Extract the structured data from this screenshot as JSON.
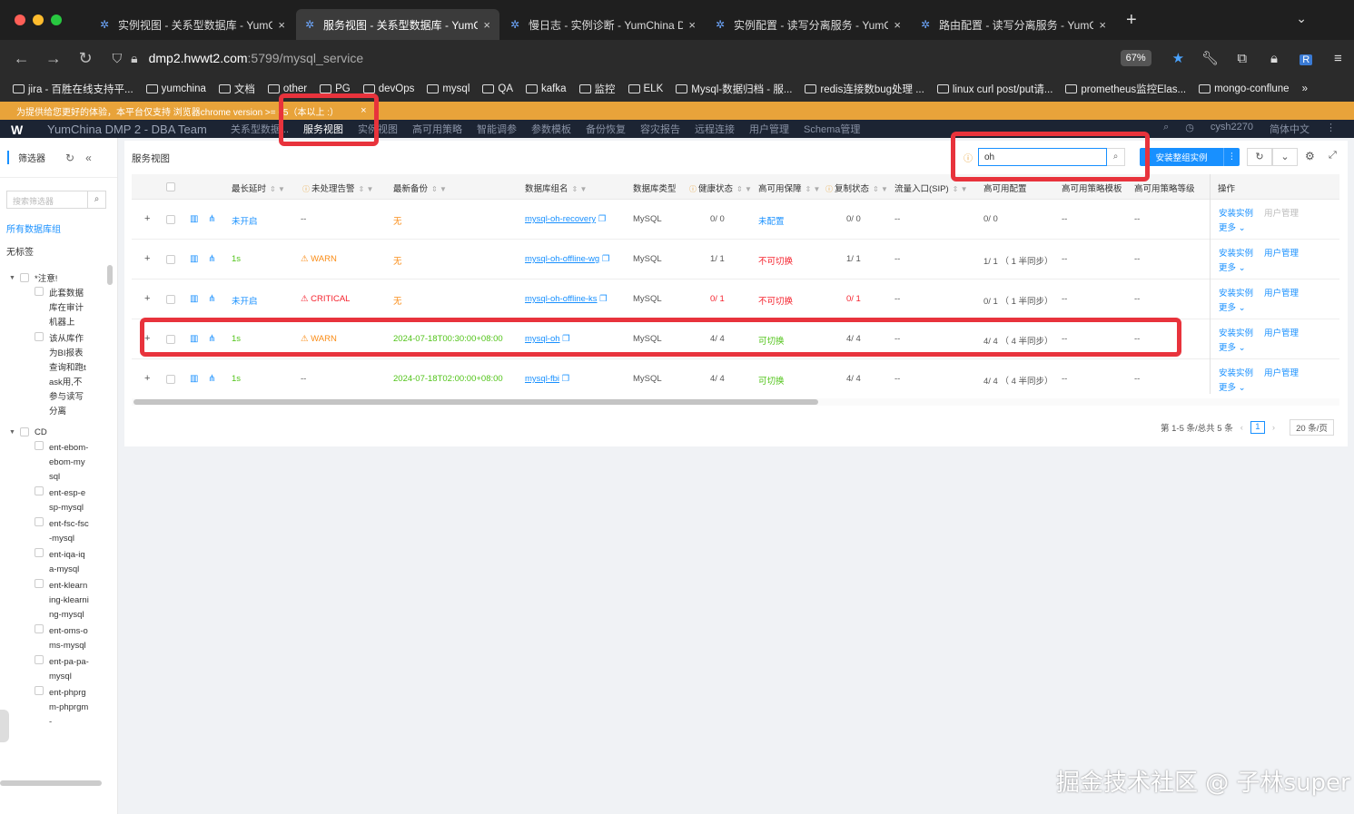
{
  "browser": {
    "tabs": [
      {
        "title": "实例视图 - 关系型数据库 - YumC",
        "active": false
      },
      {
        "title": "服务视图 - 关系型数据库 - YumC",
        "active": true
      },
      {
        "title": "慢日志 - 实例诊断 - YumChina D",
        "active": false
      },
      {
        "title": "实例配置 - 读写分离服务 - YumC",
        "active": false
      },
      {
        "title": "路由配置 - 读写分离服务 - YumC",
        "active": false
      }
    ],
    "url_host": "dmp2.hwwt2.com",
    "url_rest": ":5799/mysql_service",
    "url_prefix": "",
    "zoom": "67%",
    "bookmarks": [
      "jira - 百胜在线支持平...",
      "yumchina",
      "文档",
      "other",
      "PG",
      "devOps",
      "mysql",
      "QA",
      "kafka",
      "监控",
      "ELK",
      "Mysql-数据归档 - 服...",
      "redis连接数bug处理 ...",
      "linux curl post/put请...",
      "prometheus监控Elas...",
      "mongo-conflune"
    ]
  },
  "app": {
    "warning": "为提供给您更好的体验，本平台仅支持 浏览器chrome version >= 65（本以上 :）",
    "title": "YumChina DMP 2 - DBA Team",
    "nav": [
      "关系型数据...",
      "服务视图",
      "实例视图",
      "高可用策略",
      "智能调参",
      "参数模板",
      "备份恢复",
      "容灾报告",
      "远程连接",
      "用户管理",
      "Schema管理"
    ],
    "user": "cysh2270",
    "lang": "简体中文"
  },
  "sidebar": {
    "filter_label": "筛选器",
    "search_placeholder": "搜索筛选器",
    "all_groups": "所有数据库组",
    "untagged": "无标签",
    "tree": [
      {
        "group": "*注意!",
        "items": [
          "此套数据库在审计机器上",
          "该从库作为BI报表查询和跑task用,不参与读写分离"
        ]
      },
      {
        "group": "CD",
        "items": [
          "ent-ebom-ebom-mysql",
          "ent-esp-esp-mysql",
          "ent-fsc-fsc-mysql",
          "ent-iqa-iqa-mysql",
          "ent-klearning-klearning-mysql",
          "ent-oms-oms-mysql",
          "ent-pa-pa-mysql",
          "ent-phprgm-phprgm-"
        ]
      }
    ]
  },
  "panel": {
    "title": "服务视图",
    "search_value": "oh",
    "install_button": "安装整组实例",
    "columns": [
      "最长延时",
      "未处理告警",
      "最新备份",
      "数据库组名",
      "数据库类型",
      "健康状态",
      "高可用保障",
      "复制状态",
      "流量入口(SIP)",
      "高可用配置",
      "高可用策略模板",
      "高可用策略等级",
      "操作"
    ],
    "rows": [
      {
        "delay": "未开启",
        "delay_color": "#1890ff",
        "alert": "--",
        "alert_type": "none",
        "backup": "无",
        "backup_color": "#fa8c16",
        "group": "mysql-oh-recovery",
        "dbtype": "MySQL",
        "health": "0/ 0",
        "health_color": "#555",
        "ha": "未配置",
        "ha_color": "#1890ff",
        "repl": "0/ 0",
        "repl_color": "#555",
        "sip": "--",
        "haconf": "0/ 0",
        "tpl": "--",
        "level": "--",
        "op1": "安装实例",
        "op2": "用户管理",
        "op2_disabled": true,
        "op3": "更多"
      },
      {
        "delay": "1s",
        "delay_color": "#52c41a",
        "alert": "WARN",
        "alert_type": "warn",
        "backup": "无",
        "backup_color": "#fa8c16",
        "group": "mysql-oh-offline-wg",
        "dbtype": "MySQL",
        "health": "1/ 1",
        "health_color": "#555",
        "ha": "不可切换",
        "ha_color": "#f5222d",
        "repl": "1/ 1",
        "repl_color": "#555",
        "sip": "--",
        "haconf": "1/ 1 （ 1 半同步）",
        "tpl": "--",
        "level": "--",
        "op1": "安装实例",
        "op2": "用户管理",
        "op2_disabled": false,
        "op3": "更多"
      },
      {
        "delay": "未开启",
        "delay_color": "#1890ff",
        "alert": "CRITICAL",
        "alert_type": "critical",
        "backup": "无",
        "backup_color": "#fa8c16",
        "group": "mysql-oh-offline-ks",
        "dbtype": "MySQL",
        "health": "0/ 1",
        "health_color": "#f5222d",
        "ha": "不可切换",
        "ha_color": "#f5222d",
        "repl": "0/ 1",
        "repl_color": "#f5222d",
        "sip": "--",
        "haconf": "0/ 1 （ 1 半同步）",
        "tpl": "--",
        "level": "--",
        "op1": "安装实例",
        "op2": "用户管理",
        "op2_disabled": false,
        "op3": "更多"
      },
      {
        "delay": "1s",
        "delay_color": "#52c41a",
        "alert": "WARN",
        "alert_type": "warn",
        "backup": "2024-07-18T00:30:00+08:00",
        "backup_color": "#52c41a",
        "group": "mysql-oh",
        "dbtype": "MySQL",
        "health": "4/ 4",
        "health_color": "#555",
        "ha": "可切换",
        "ha_color": "#52c41a",
        "repl": "4/ 4",
        "repl_color": "#555",
        "sip": "--",
        "haconf": "4/ 4 （ 4 半同步）",
        "tpl": "--",
        "level": "--",
        "op1": "安装实例",
        "op2": "用户管理",
        "op2_disabled": false,
        "op3": "更多"
      },
      {
        "delay": "1s",
        "delay_color": "#52c41a",
        "alert": "--",
        "alert_type": "none",
        "backup": "2024-07-18T02:00:00+08:00",
        "backup_color": "#52c41a",
        "group": "mysql-fbi",
        "dbtype": "MySQL",
        "health": "4/ 4",
        "health_color": "#555",
        "ha": "可切换",
        "ha_color": "#52c41a",
        "repl": "4/ 4",
        "repl_color": "#555",
        "sip": "--",
        "haconf": "4/ 4 （ 4 半同步）",
        "tpl": "--",
        "level": "--",
        "op1": "安装实例",
        "op2": "用户管理",
        "op2_disabled": false,
        "op3": "更多"
      }
    ],
    "pager_text": "第 1-5 条/总共 5 条",
    "page": "1",
    "page_size": "20 条/页"
  },
  "watermark": "掘金技术社区 @ 子林super"
}
